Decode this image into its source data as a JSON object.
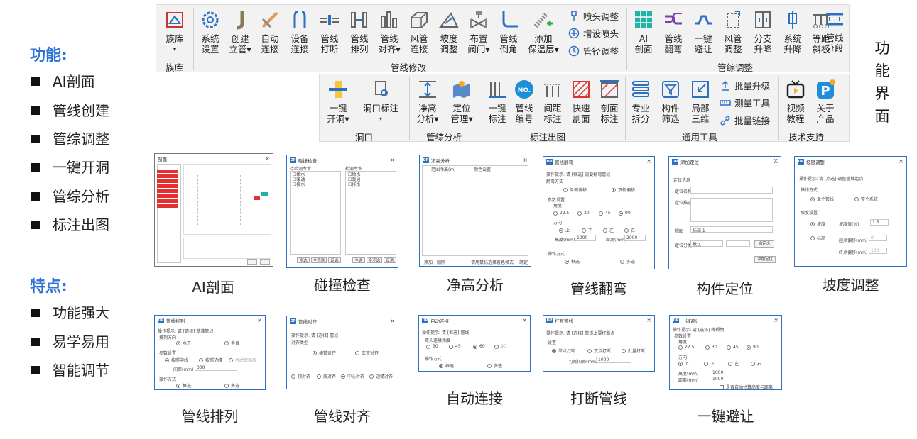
{
  "features": {
    "title": "功能:",
    "items": [
      "AI剖面",
      "管线创建",
      "管综调整",
      "一键开洞",
      "管综分析",
      "标注出图"
    ]
  },
  "traits": {
    "title": "特点:",
    "items": [
      "功能强大",
      "易学易用",
      "智能调节"
    ]
  },
  "vertical_title": [
    "功",
    "能",
    "界",
    "面"
  ],
  "ribbon_top": {
    "family": {
      "label1": "族库",
      "label2": "",
      "group": "族库"
    },
    "buttons": [
      {
        "l1": "系统",
        "l2": "设置"
      },
      {
        "l1": "创建",
        "l2": "立管"
      },
      {
        "l1": "自动",
        "l2": "连接"
      },
      {
        "l1": "设备",
        "l2": "连接"
      },
      {
        "l1": "管线",
        "l2": "打断"
      },
      {
        "l1": "管线",
        "l2": "排列"
      },
      {
        "l1": "管线",
        "l2": "对齐"
      },
      {
        "l1": "风管",
        "l2": "连接"
      },
      {
        "l1": "坡度",
        "l2": "调整"
      },
      {
        "l1": "布置",
        "l2": "阀门"
      },
      {
        "l1": "管线",
        "l2": "倒角"
      },
      {
        "l1": "添加",
        "l2": "保温层"
      }
    ],
    "small": [
      "喷头调整",
      "增设喷头",
      "管径调整"
    ],
    "group_main": "管线修改",
    "right_buttons": [
      {
        "l1": "AI",
        "l2": "剖面"
      },
      {
        "l1": "管线",
        "l2": "翻弯"
      },
      {
        "l1": "一键",
        "l2": "避让"
      },
      {
        "l1": "风管",
        "l2": "调整"
      },
      {
        "l1": "分支",
        "l2": "升降"
      },
      {
        "l1": "系统",
        "l2": "升降"
      },
      {
        "l1": "等距",
        "l2": "斜板"
      },
      {
        "l1": "管线",
        "l2": "分段"
      }
    ],
    "group_right": "管综调整"
  },
  "ribbon_bottom": {
    "buttons": [
      {
        "l1": "一键",
        "l2": "开洞"
      },
      {
        "l1": "洞口标注",
        "l2": ""
      },
      {
        "l1": "净高",
        "l2": "分析"
      },
      {
        "l1": "定位",
        "l2": "管理"
      },
      {
        "l1": "一键",
        "l2": "标注"
      },
      {
        "l1": "管线",
        "l2": "编号"
      },
      {
        "l1": "间距",
        "l2": "标注"
      },
      {
        "l1": "快速",
        "l2": "剖面"
      },
      {
        "l1": "剖面",
        "l2": "标注"
      },
      {
        "l1": "专业",
        "l2": "拆分"
      },
      {
        "l1": "构件",
        "l2": "筛选"
      },
      {
        "l1": "局部",
        "l2": "三维"
      },
      {
        "l1": "视频",
        "l2": "教程"
      },
      {
        "l1": "关于",
        "l2": "产品"
      }
    ],
    "small": [
      "批量升级",
      "测量工具",
      "批量链接"
    ],
    "groups": [
      "洞口",
      "管综分析",
      "标注出图",
      "通用工具",
      "技术支持"
    ]
  },
  "dialogs": {
    "ai": {
      "title": "剖面"
    },
    "collision": {
      "title": "碰撞检查",
      "left_label": "待检测专业",
      "right_label": "检测专业",
      "items": [
        "给水",
        "暖通",
        "排水"
      ],
      "btns": [
        "全选",
        "全不选",
        "反选"
      ]
    },
    "clearance": {
      "title": "净高分析",
      "cols": [
        "范围净高(m)",
        "颜色设置"
      ],
      "footer": [
        "添加",
        "删除",
        "请用鼠标选择着色模式",
        "确定"
      ]
    },
    "flip": {
      "title": "管线翻弯",
      "hint": "操作提示: 请 [框选] 需要翻弯管线",
      "mode": "翻弯方式",
      "single": "单侧偏移",
      "double": "双侧偏移",
      "param": "参数设置",
      "angle": "角度",
      "angles": [
        "22.5",
        "30",
        "45",
        "90"
      ],
      "dir": "方向",
      "dirs": [
        "上",
        "下",
        "左",
        "右"
      ],
      "h_label": "高度(mm)",
      "h": "1000",
      "d_label": "距离(mm)",
      "d": "2000",
      "op": "操作方式",
      "box": "框选",
      "multi": "多选"
    },
    "locate": {
      "title": "添加定位",
      "info": "定位信息",
      "name": "定位名称",
      "desc": "定位描述",
      "view": "视图",
      "view_val": "标高 1",
      "cat": "定位分类",
      "cat_val": "默认",
      "custom": "自定义",
      "add": "添加定位"
    },
    "slope": {
      "title": "坡度调整",
      "hint": "操作提示: 请 [点选] 调整管线起点",
      "op": "操作方式",
      "single": "单个管线",
      "whole": "整个系统",
      "set": "坡度设置",
      "slope": "坡度",
      "slope_val_label": "坡度值(%)",
      "slope_val": "1.5",
      "elev": "标高",
      "start": "起点偏移(mm)",
      "start_val": "0",
      "end": "终点偏移(mm)",
      "end_val": "100"
    },
    "arrange": {
      "title": "管线排列",
      "hint": "操作提示: 请 [选择] 基准管线",
      "dir": "排列方向",
      "horiz": "水平",
      "vert": "垂直",
      "param": "参数设置",
      "opts": [
        "按照中线",
        "按照边缘",
        "考虑保温层"
      ],
      "gap_label": "间距(mm)",
      "gap": "300",
      "op": "操作方式",
      "box": "框选",
      "multi": "多选"
    },
    "align": {
      "title": "管线对齐",
      "hint": "操作提示: 请 [选择] 管线",
      "type": "对齐类型",
      "t1": "横管对齐",
      "t2": "立管对齐",
      "opts": [
        "顶对齐",
        "底对齐",
        "中心对齐",
        "边缘对齐"
      ]
    },
    "connect": {
      "title": "自动连接",
      "hint": "操作提示: 请 [框选] 管线",
      "angle": "弯头连接角度",
      "angles": [
        "30",
        "45",
        "60",
        "90"
      ],
      "op": "操作方式",
      "box": "框选",
      "multi": "多选"
    },
    "break": {
      "title": "打断管线",
      "hint": "操作提示: 请 [选择] 管道上要打断点",
      "set": "设置",
      "opts": [
        "单点打断",
        "双点打断",
        "批量打断"
      ],
      "gap_label": "打断间距(mm)",
      "gap": "1000"
    },
    "avoid": {
      "title": "一键避让",
      "hint": "操作提示: 请 [选择] 障碍物",
      "param": "参数设置",
      "angle": "角度",
      "angles": [
        "22.5",
        "30",
        "45",
        "90"
      ],
      "dir": "方向",
      "dirs": [
        "上",
        "下",
        "左",
        "右"
      ],
      "h_label": "高度(mm)",
      "h": "1000",
      "d_label": "距离(mm)",
      "d": "1000",
      "check": "是否自动计算高度与距离"
    }
  },
  "captions": [
    "AI剖面",
    "碰撞检查",
    "净高分析",
    "管线翻弯",
    "构件定位",
    "坡度调整",
    "管线排列",
    "管线对齐",
    "自动连接",
    "打断管线",
    "一键避让"
  ],
  "colors": {
    "accent": "#2e73d8",
    "dialog_border": "#2d6fc0",
    "red_row": "#e53030",
    "teal": "#22b3a8"
  }
}
